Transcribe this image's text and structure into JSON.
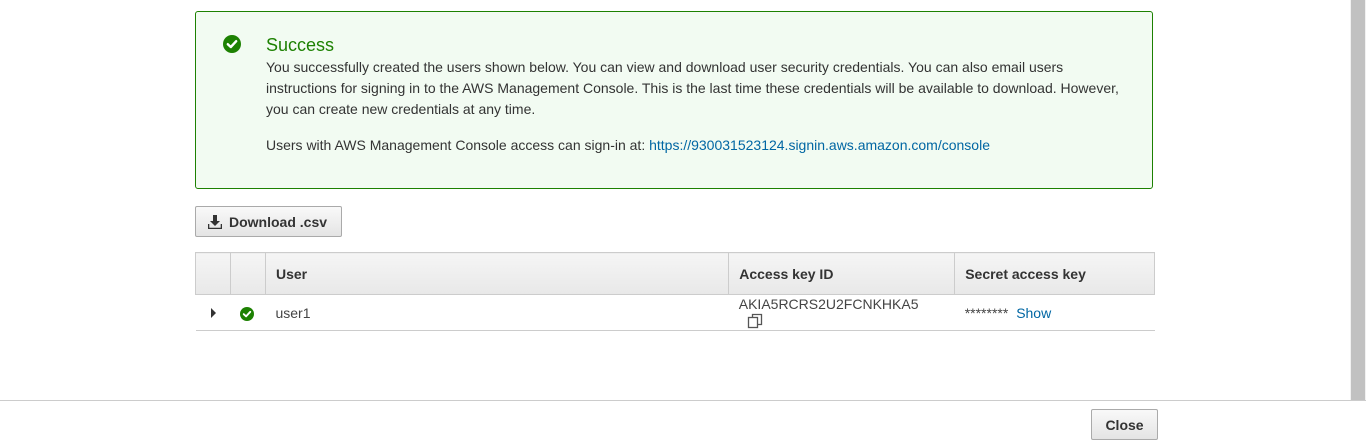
{
  "alert": {
    "icon": "check-circle-icon",
    "title": "Success",
    "message": "You successfully created the users shown below. You can view and download user security credentials. You can also email users instructions for signing in to the AWS Management Console. This is the last time these credentials will be available to download. However, you can create new credentials at any time.",
    "signin_prefix": "Users with AWS Management Console access can sign-in at:",
    "signin_url": "https://930031523124.signin.aws.amazon.com/console",
    "color": "#1d8102",
    "background": "#f2fbf2"
  },
  "toolbar": {
    "download_label": "Download .csv",
    "download_icon": "download-icon"
  },
  "table": {
    "columns": [
      "",
      "",
      "User",
      "Access key ID",
      "Secret access key"
    ],
    "rows": [
      {
        "status_icon": "check-circle-icon",
        "user": "user1",
        "access_key_id": "AKIA5RCRS2U2FCNKHKA5",
        "secret_masked": "********",
        "show_label": "Show"
      }
    ]
  },
  "footer": {
    "close_label": "Close"
  },
  "colors": {
    "link": "#0066a3",
    "success": "#1d8102"
  }
}
